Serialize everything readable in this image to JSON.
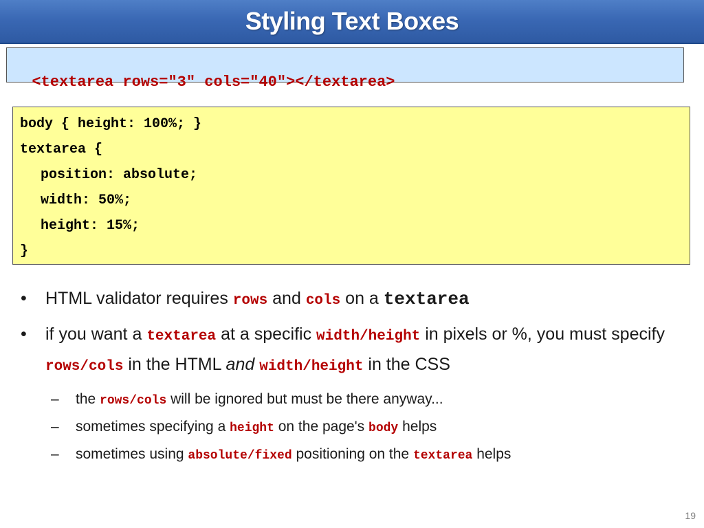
{
  "slide": {
    "title": "Styling Text Boxes",
    "page_number": "19"
  },
  "html_code": "<textarea rows=\"3\" cols=\"40\"></textarea>",
  "css_code": [
    "body { height: 100%; }",
    "textarea {",
    "position: absolute;",
    "width: 50%;",
    "height: 15%;",
    "}"
  ],
  "bullets": {
    "b1": {
      "t1": "HTML validator requires ",
      "k1": "rows",
      "t2": " and ",
      "k2": "cols",
      "t3": " on a ",
      "k3": "textarea"
    },
    "b2": {
      "t1": "if you want a ",
      "k1": "textarea",
      "t2": " at a specific ",
      "k2": "width/height",
      "t3": " in pixels or %, you must specify ",
      "k3": "rows/cols",
      "t4": " in the HTML ",
      "em": "and",
      "t5": " ",
      "k4": "width/height",
      "t6": " in the CSS"
    },
    "sub1": {
      "t1": "the ",
      "k1": "rows/cols",
      "t2": " will be ignored but must be there anyway..."
    },
    "sub2": {
      "t1": "sometimes specifying a ",
      "k1": "height",
      "t2": " on the page's ",
      "k2": "body",
      "t3": " helps"
    },
    "sub3": {
      "t1": "sometimes using ",
      "k1": "absolute/fixed",
      "t2": " positioning on the ",
      "k2": "textarea",
      "t3": " helps"
    }
  },
  "colors": {
    "title_bar": "#3a68b4",
    "html_box_bg": "#cce6ff",
    "css_box_bg": "#ffff99",
    "keyword": "#b40000"
  }
}
